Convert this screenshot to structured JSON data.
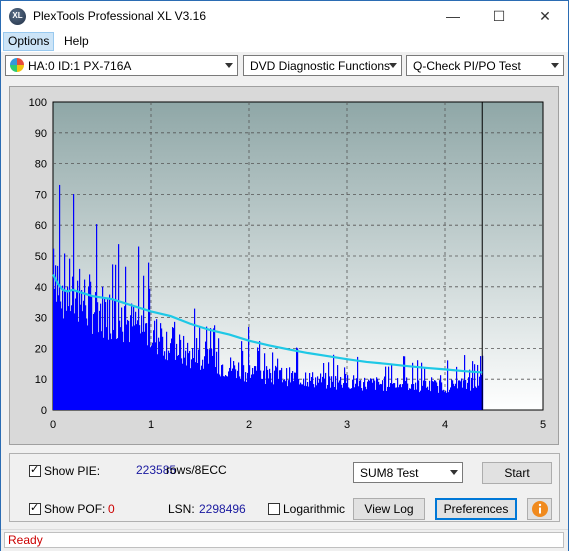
{
  "window": {
    "title": "PlexTools Professional XL V3.16",
    "icon_label": "XL"
  },
  "menu": [
    {
      "label": "Options"
    },
    {
      "label": "Help"
    }
  ],
  "toolbar": {
    "drive": "HA:0 ID:1  PX-716A",
    "function": "DVD Diagnostic Functions",
    "test": "Q-Check PI/PO Test"
  },
  "chart_data": {
    "type": "bar",
    "title": "",
    "xlabel": "",
    "ylabel": "",
    "xlim": [
      0,
      5
    ],
    "ylim": [
      0,
      100
    ],
    "x_ticks": [
      "0",
      "1",
      "2",
      "3",
      "4",
      "5"
    ],
    "y_ticks": [
      "0",
      "10",
      "20",
      "30",
      "40",
      "50",
      "60",
      "70",
      "80",
      "90",
      "100"
    ],
    "grid": true,
    "data_end_x": 4.38,
    "series": [
      {
        "name": "PIE",
        "color": "#0000ff",
        "note": "per-position error counts (estimated envelope)",
        "x": [
          0.0,
          0.05,
          0.1,
          0.15,
          0.2,
          0.3,
          0.4,
          0.5,
          0.6,
          0.7,
          0.8,
          0.9,
          1.0,
          1.1,
          1.2,
          1.3,
          1.4,
          1.5,
          1.6,
          1.7,
          1.8,
          1.9,
          2.0,
          2.2,
          2.4,
          2.6,
          2.8,
          3.0,
          3.2,
          3.4,
          3.6,
          3.8,
          4.0,
          4.2,
          4.38
        ],
        "values": [
          68,
          55,
          52,
          50,
          48,
          46,
          44,
          42,
          40,
          38,
          36,
          34,
          32,
          30,
          28,
          25,
          23,
          21,
          20,
          19,
          18,
          17,
          16,
          15,
          14,
          13,
          12,
          12,
          11,
          11,
          11,
          10,
          10,
          11,
          12
        ]
      },
      {
        "name": "SUM8",
        "color": "#1ec8e6",
        "x": [
          0.0,
          0.05,
          0.1,
          0.15,
          0.2,
          0.3,
          0.4,
          0.5,
          0.6,
          0.8,
          1.0,
          1.2,
          1.4,
          1.6,
          1.8,
          2.0,
          2.2,
          2.4,
          2.6,
          2.8,
          3.0,
          3.2,
          3.4,
          3.6,
          3.8,
          4.0,
          4.2,
          4.38
        ],
        "values": [
          44,
          41,
          39,
          38.5,
          39,
          38,
          37,
          36.5,
          36,
          34,
          32,
          30.5,
          28,
          26,
          24.5,
          22.5,
          21,
          19.7,
          18.5,
          17.5,
          16.5,
          15.6,
          15,
          14.3,
          13.7,
          13.2,
          12.6,
          12.2
        ]
      }
    ]
  },
  "controls": {
    "show_pie_label": "Show PIE:",
    "pie_value": "223585",
    "pie_unit": "rows/8ECC",
    "show_pof_label": "Show POF:",
    "pof_value": "0",
    "lsn_label": "LSN:",
    "lsn_value": "2298496",
    "logarithmic_label": "Logarithmic",
    "test_select": "SUM8 Test",
    "start_button": "Start",
    "viewlog_button": "View Log",
    "prefs_button": "Preferences"
  },
  "status": {
    "text": "Ready",
    "color": "#cc0000"
  }
}
